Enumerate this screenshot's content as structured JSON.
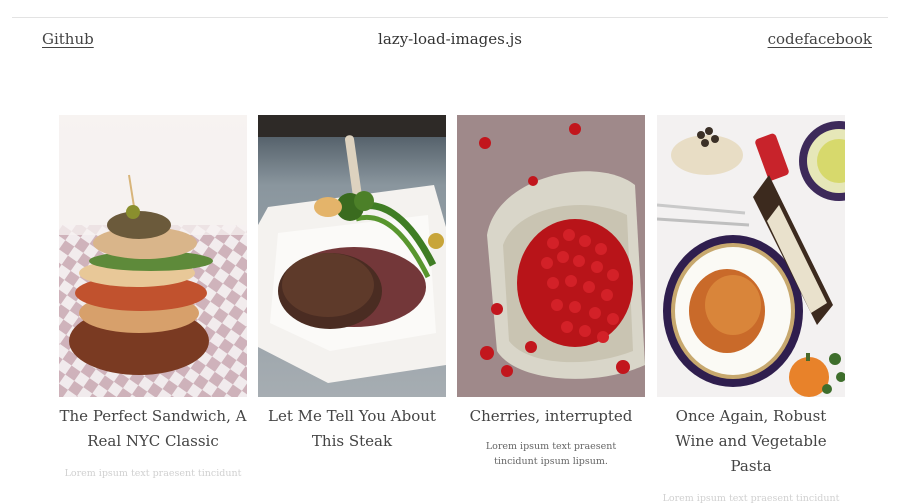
{
  "header": {
    "left_link": "Github",
    "title": "lazy-load-images.js",
    "right_link": "codefacebook"
  },
  "cards": [
    {
      "title": "The Perfect Sandwich, A Real NYC Classic",
      "excerpt": "",
      "faded": "Lorem ipsum text praesent tincidunt ipsum lipsum."
    },
    {
      "title": "Let Me Tell You About This Steak",
      "excerpt": "",
      "faded": ""
    },
    {
      "title": "Cherries, interrupted",
      "excerpt": "Lorem ipsum text praesent tincidunt ipsum lipsum.",
      "faded": ""
    },
    {
      "title": "Once Again, Robust Wine and Vegetable Pasta",
      "excerpt": "",
      "faded": "Lorem ipsum text praesent tincidunt ipsum lipsum."
    }
  ],
  "colors": {
    "link": "#444444",
    "divider": "#e3e3e3"
  }
}
